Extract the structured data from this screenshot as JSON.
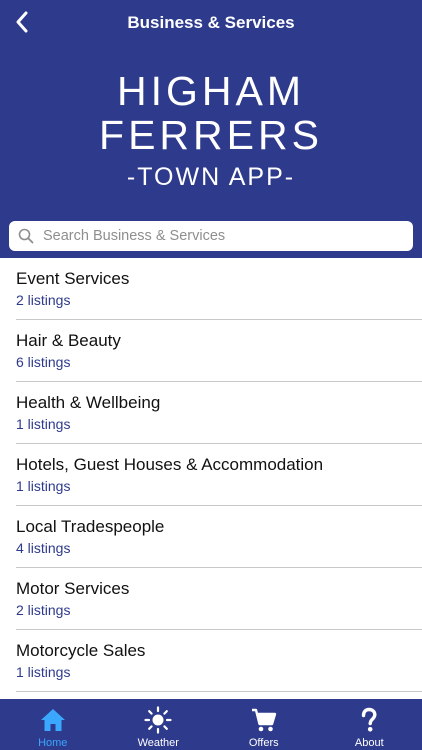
{
  "header": {
    "title": "Business & Services"
  },
  "logo": {
    "line1": "HIGHAM",
    "line2": "FERRERS",
    "line3": "-TOWN APP-"
  },
  "search": {
    "placeholder": "Search Business & Services"
  },
  "categories": [
    {
      "name": "Event Services",
      "count": "2 listings"
    },
    {
      "name": "Hair & Beauty",
      "count": "6 listings"
    },
    {
      "name": "Health & Wellbeing",
      "count": "1 listings"
    },
    {
      "name": "Hotels, Guest Houses & Accommodation",
      "count": "1 listings"
    },
    {
      "name": "Local Tradespeople",
      "count": "4 listings"
    },
    {
      "name": "Motor Services",
      "count": "2 listings"
    },
    {
      "name": "Motorcycle Sales",
      "count": "1 listings"
    }
  ],
  "tabs": [
    {
      "label": "Home",
      "icon": "home-icon",
      "active": true
    },
    {
      "label": "Weather",
      "icon": "sun-icon"
    },
    {
      "label": "Offers",
      "icon": "cart-icon"
    },
    {
      "label": "About",
      "icon": "question-icon"
    }
  ],
  "colors": {
    "brand": "#2e3a8c",
    "active_tab": "#3aa8ff",
    "count_text": "#2e3a8c"
  }
}
